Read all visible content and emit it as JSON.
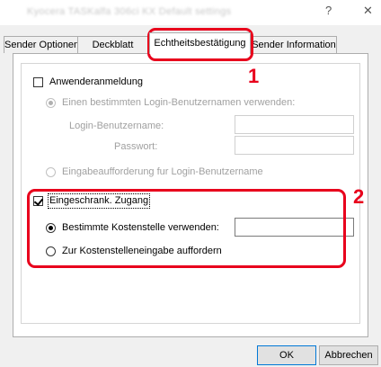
{
  "window": {
    "title": "Kyocera TASKalfa 306ci KX Default settings",
    "help_glyph": "?",
    "close_glyph": "✕"
  },
  "tabs": [
    {
      "label": "Sender Optionen"
    },
    {
      "label": "Deckblatt"
    },
    {
      "label": "Echtheitsbestätigung"
    },
    {
      "label": "Sender Information"
    }
  ],
  "auth": {
    "user_login_label": "Anwenderanmeldung",
    "user_login_checked": false,
    "use_specific_name_label": "Einen bestimmten Login-Benutzernamen verwenden:",
    "login_name_label": "Login-Benutzername:",
    "login_name_value": "",
    "password_label": "Passwort:",
    "password_value": "",
    "prompt_login_label": "Eingabeaufforderung fur Login-Benutzername"
  },
  "restricted": {
    "label": "Eingeschrank. Zugang",
    "checked": true,
    "use_cost_center_label": "Bestimmte Kostenstelle verwenden:",
    "cost_center_value": "",
    "prompt_cost_center_label": "Zur Kostenstelleneingabe auffordern"
  },
  "callouts": {
    "one": "1",
    "two": "2"
  },
  "buttons": {
    "ok": "OK",
    "cancel": "Abbrechen"
  },
  "colors": {
    "highlight": "#e8001c"
  }
}
